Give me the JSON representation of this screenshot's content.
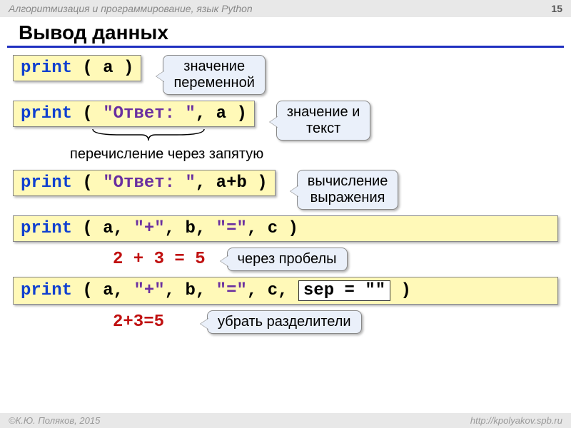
{
  "header": {
    "course": "Алгоритмизация и программирование, язык Python",
    "page": "15"
  },
  "title": "Вывод данных",
  "rows": {
    "r1": {
      "kw": "print",
      "args": " ( a )",
      "callout": "значение\nпеременной"
    },
    "r2": {
      "kw": "print",
      "pre": " ( ",
      "str": "\"Ответ: \"",
      "post": ", a )",
      "callout": "значение и\nтекст"
    },
    "note2": "перечисление через запятую",
    "r3": {
      "kw": "print",
      "pre": " ( ",
      "str": "\"Ответ: \"",
      "post": ", a+b )",
      "callout": "вычисление\nвыражения"
    },
    "r4": {
      "kw": "print",
      "pre": " ( a, ",
      "s1": "\"+\"",
      "mid1": ", b, ",
      "s2": "\"=\"",
      "post": ", c )"
    },
    "out4": {
      "text": "2 + 3 = 5",
      "callout": "через пробелы"
    },
    "r5": {
      "kw": "print",
      "pre": " ( a, ",
      "s1": "\"+\"",
      "mid1": ", b, ",
      "s2": "\"=\"",
      "mid2": ", c, ",
      "sep": "sep = \"\"",
      "post": " )"
    },
    "out5": {
      "text": "2+3=5",
      "callout": "убрать разделители"
    }
  },
  "footer": {
    "left": "©К.Ю. Поляков, 2015",
    "right": "http://kpolyakov.spb.ru"
  }
}
